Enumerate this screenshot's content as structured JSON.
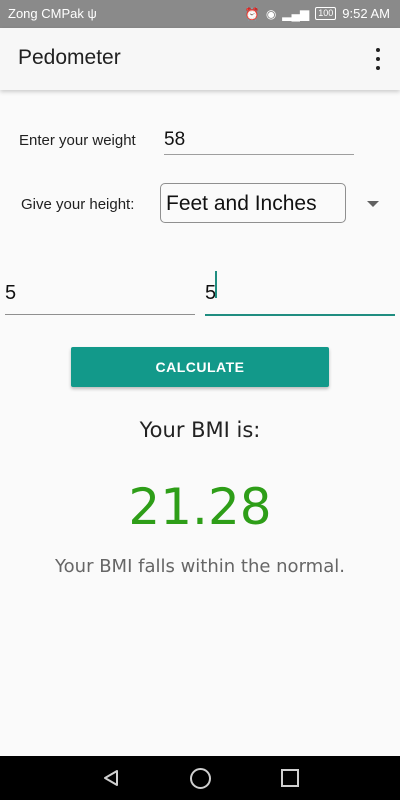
{
  "status_bar": {
    "carrier": "Zong CMPak",
    "usb_symbol": "ψ",
    "battery": "100",
    "time": "9:52 AM",
    "icons": [
      "alarm-icon",
      "eye-icon",
      "4g-signal-icon",
      "battery-icon"
    ]
  },
  "app_bar": {
    "title": "Pedometer",
    "menu_icon": "overflow-menu-icon"
  },
  "form": {
    "weight_label": "Enter your weight",
    "weight_value": "58",
    "height_label": "Give your height:",
    "height_unit_selected": "Feet and Inches",
    "feet_value": "5",
    "inches_value": "5"
  },
  "button": {
    "calculate_label": "CALCULATE"
  },
  "result": {
    "heading": "Your BMI is:",
    "value": "21.28",
    "message": "Your BMI falls within the normal."
  },
  "colors": {
    "accent": "#12998a",
    "bmi_value": "#2e9e18",
    "status_bar": "#8a8a8a"
  },
  "nav_bar": {
    "icons": [
      "back-icon",
      "home-icon",
      "recent-apps-icon"
    ]
  }
}
